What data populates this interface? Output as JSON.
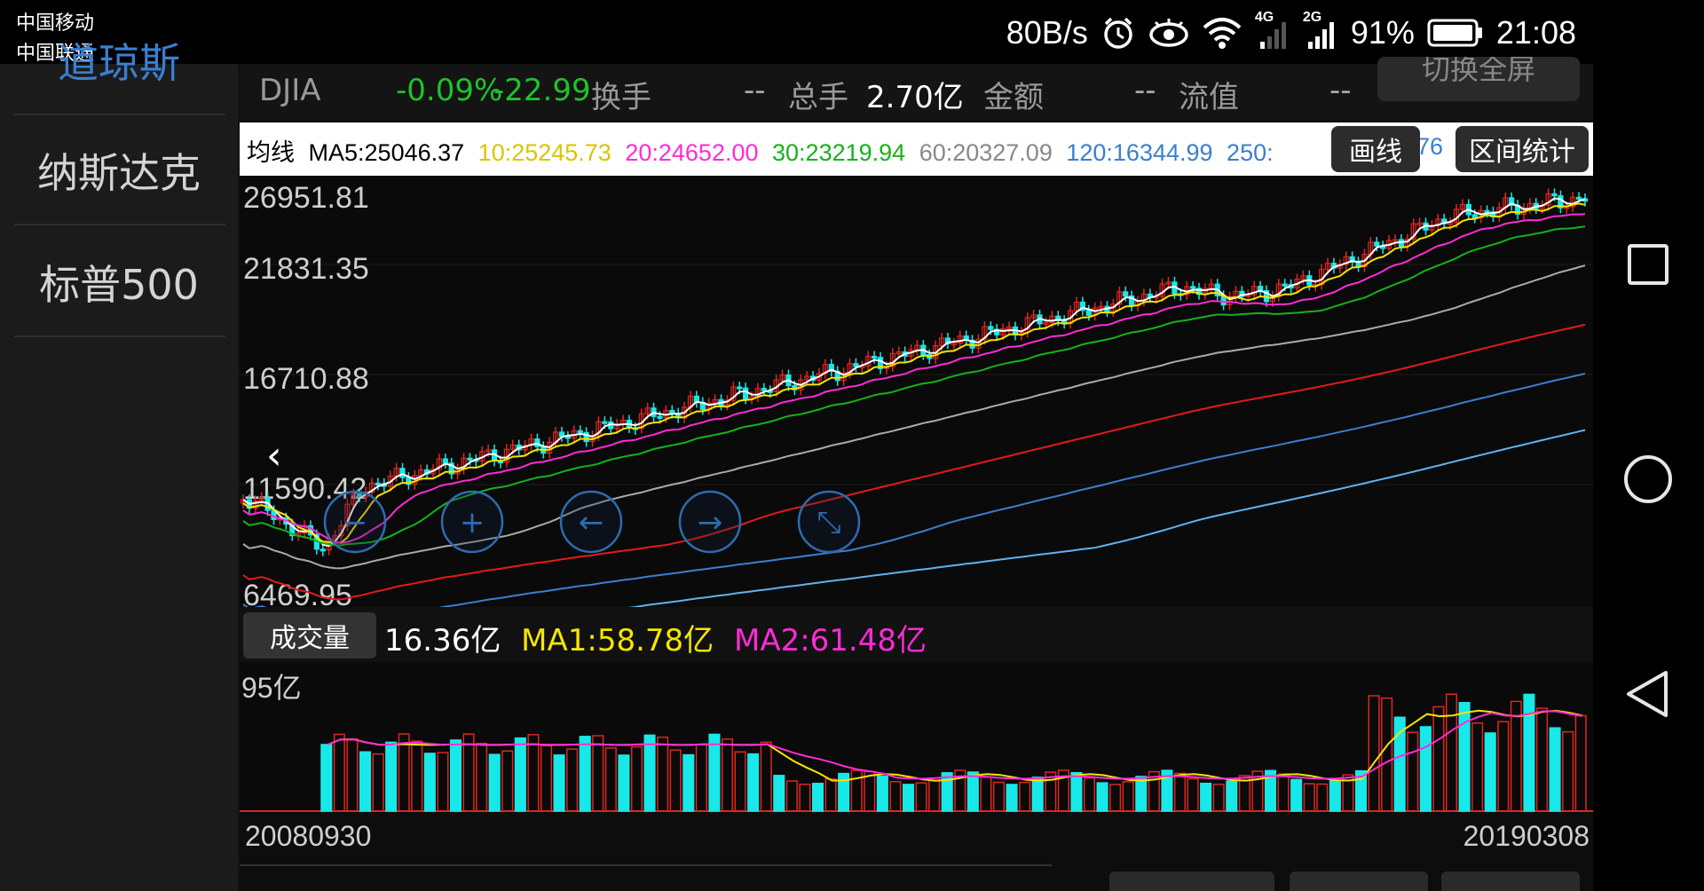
{
  "status_bar": {
    "carrier1": "中国移动",
    "carrier2": "中国联通",
    "net_speed": "80B/s",
    "sig1": "4G",
    "sig2": "2G",
    "battery": "91%",
    "time": "21:08",
    "icons": [
      "alarm-icon",
      "eye-icon",
      "wifi-icon",
      "signal-4g-icon",
      "signal-2g-icon",
      "battery-icon"
    ]
  },
  "sidebar": {
    "items": [
      {
        "label": "道琼斯"
      },
      {
        "label": "纳斯达克"
      },
      {
        "label": "标普500"
      }
    ]
  },
  "quote": {
    "name": "DJIA",
    "pct": "-0.09%",
    "chg": "-22.99",
    "turnover_label": "换手",
    "turnover_val": "--",
    "total_label": "总手",
    "total_val": "2.70亿",
    "amount_label": "金额",
    "amount_val": "--",
    "cap_label": "流值",
    "cap_val": "--",
    "fullscreen": "切换全屏"
  },
  "ma_line": {
    "prefix": "均线",
    "ma5": "MA5:25046.37",
    "ma10": "10:25245.73",
    "ma20": "20:24652.00",
    "ma30": "30:23219.94",
    "ma60": "60:20327.09",
    "ma120": "120:16344.99",
    "ma250": "250:",
    "ma250_tail": "76",
    "draw_btn": "画线",
    "range_btn": "区间统计"
  },
  "colors": {
    "ma5": "#ffffff",
    "ma10": "#f5e600",
    "ma20": "#ff2bd6",
    "ma30": "#16b21a",
    "ma60": "#aaaaaa",
    "ma120": "#e31a1a",
    "ma250": "#3a7fd0",
    "ma_extra": "#5fb2f0",
    "up": "#e0261e",
    "down": "#18e8e8"
  },
  "chart_data": {
    "type": "candlestick",
    "y_ticks": [
      "26951.81",
      "21831.35",
      "16710.88",
      "11590.42",
      "6469.95"
    ],
    "x_start": "20080930",
    "x_end": "20190308",
    "ma_latest": {
      "MA5": 25046.37,
      "MA10": 25245.73,
      "MA20": 24652.0,
      "MA30": 23219.94,
      "MA60": 20327.09,
      "MA120": 16344.99
    }
  },
  "volume": {
    "button": "成交量",
    "value": "16.36亿",
    "ma1": "MA1:58.78亿",
    "ma2": "MA2:61.48亿",
    "y_top": "95亿"
  },
  "nav": {
    "icons": [
      "recent-apps-icon",
      "home-icon",
      "back-icon"
    ]
  }
}
